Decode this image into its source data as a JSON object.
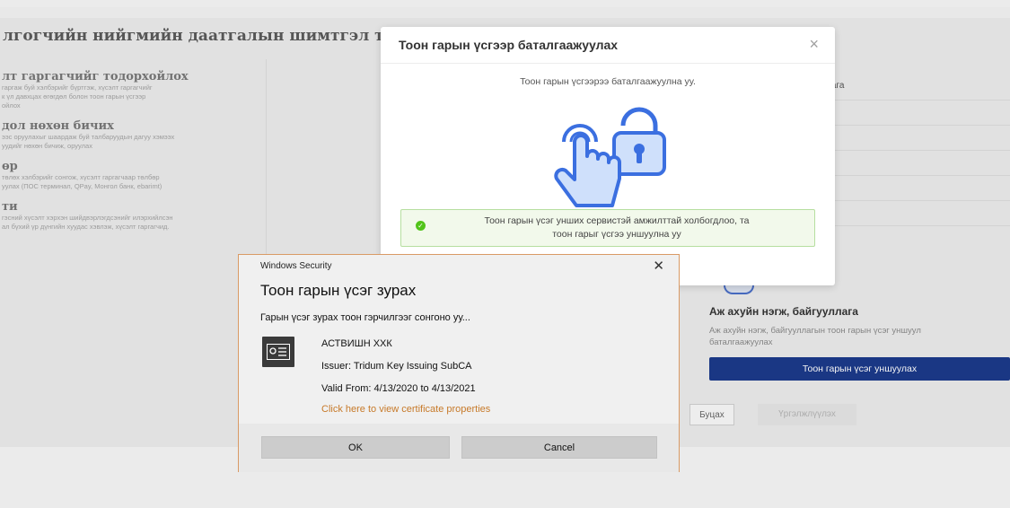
{
  "page": {
    "title": "лгогчийн нийгмийн даатгалын шимтгэл төл",
    "steps": [
      {
        "title": "лт гаргагчийг тодорхойлох",
        "desc": "гаргаж буй хэлбэрийг бүртгэж, хүсэлт гаргагчийг\nк үл давхцах өгөгдөл болон тоон гарын үсгээр\nойлох"
      },
      {
        "title": "дол нөхөн бичих",
        "desc": "ээс оруулахыг шаардаж буй талбаруудын дагуу хэмээх\nуудийг нөхөн бичиж, оруулах"
      },
      {
        "title": "өр",
        "desc": "төлөх хэлбэрийг сонгож, хүсэлт гаргагчаар төлбөр\nуулах (ПОС терминал, QPay, Монгол банк, ebarimt)"
      },
      {
        "title": "ти",
        "desc": "гэсний хүсэлт хэрхэн шийдвэрлэгдсэнийг илэрхийлсэн\nал бүхий үр дүнгийн хуудас хэвлэж, хүсэлт гаргагчид."
      }
    ],
    "right_rows": [
      "лага",
      "",
      "",
      "",
      "",
      ""
    ],
    "org": {
      "title": "Аж ахуйн нэгж, байгууллага",
      "desc": "Аж ахуйн нэгж, байгууллагын тоон гарын үсэг уншуул",
      "desc2": "баталгаажуулах",
      "button": "Тоон гарын үсэг уншуулах"
    },
    "back_button": "Буцах",
    "continue_button": "Үргэлжлүүлэх"
  },
  "modal": {
    "title": "Тоон гарын үсгээр баталгаажуулах",
    "question": "Тоон гарын үсгээрээ баталгаажуулна уу.",
    "alert_line1": "Тоон гарын үсэг унших сервистэй амжилттай холбогдлоо, та",
    "alert_line2": "тоон гарыг үсгээ уншуулна уу",
    "illustration": "hand-tap-lock-icon"
  },
  "windows_security": {
    "header": "Windows Security",
    "title": "Тоон гарын үсэг зурах",
    "prompt": "Гарын үсэг зурах тоон гэрчилгээг сонгоно уу...",
    "cert_name": "АСТВИШН ХХК",
    "issuer": "Issuer: Tridum Key Issuing SubCA",
    "valid": "Valid From: 4/13/2020 to 4/13/2021",
    "link": "Click here to view certificate properties",
    "ok": "OK",
    "cancel": "Cancel"
  },
  "colors": {
    "primary": "#1c3a8a",
    "success": "#52c41a",
    "link": "#c77a2a",
    "dialog_border": "#d99a65"
  }
}
